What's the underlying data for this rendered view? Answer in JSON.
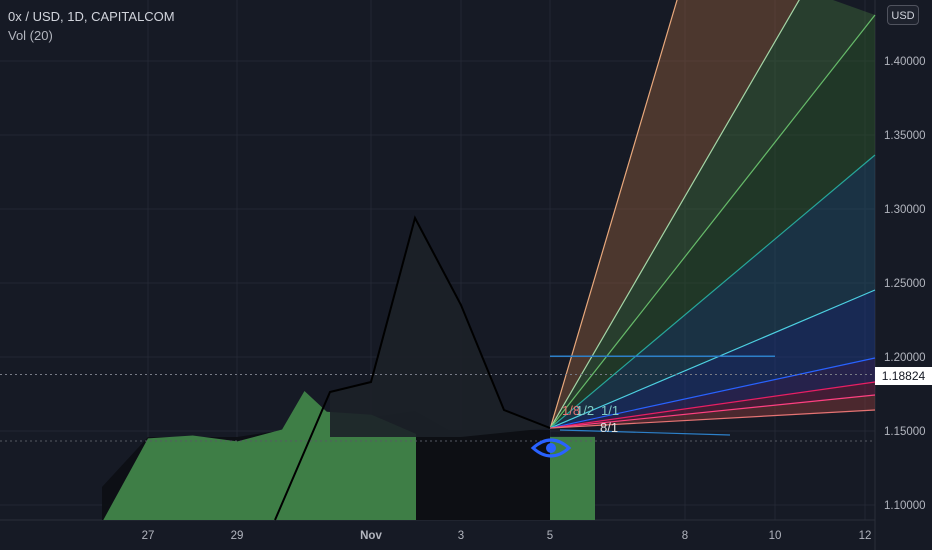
{
  "header": {
    "title": "0x / USD, 1D, CAPITALCOM",
    "volume_label": "Vol (20)"
  },
  "currency_button": "USD",
  "current_price": "1.18824",
  "colors": {
    "background": "#161a25",
    "price_line": "#000000",
    "volume_bar": "#3e7e46"
  },
  "chart_data": {
    "type": "area",
    "title": "0x / USD, 1D, CAPITALCOM",
    "y_axis": {
      "ticks": [
        "1.40000",
        "1.35000",
        "1.30000",
        "1.25000",
        "1.20000",
        "1.15000",
        "1.10000"
      ],
      "range": [
        1.088,
        1.43
      ],
      "position": "right"
    },
    "x_axis": {
      "ticks": [
        "27",
        "29",
        "Nov",
        "3",
        "5",
        "8",
        "10",
        "12"
      ]
    },
    "series": [
      {
        "name": "",
        "type": "line",
        "points": [
          {
            "x": "Oct 29",
            "y": 1.09
          },
          {
            "x": "Oct 30",
            "y": 1.165
          },
          {
            "x": "Oct 31",
            "y": 1.17
          },
          {
            "x": "Nov 1",
            "y": 1.295
          },
          {
            "x": "Nov 2",
            "y": 1.235
          },
          {
            "x": "Nov 3",
            "y": 1.155
          },
          {
            "x": "Nov 4",
            "y": 1.146
          }
        ]
      }
    ],
    "volume_area": [
      {
        "x": "Oct 26",
        "y": 1.113
      },
      {
        "x": "Oct 27",
        "y": 1.145
      },
      {
        "x": "Oct 28",
        "y": 1.147
      },
      {
        "x": "Oct 29",
        "y": 1.143
      },
      {
        "x": "Oct 30",
        "y": 1.151
      },
      {
        "x": "Oct 30.5",
        "y": 1.177
      },
      {
        "x": "Oct 31",
        "y": 1.163
      },
      {
        "x": "Nov 1",
        "y": 1.161
      },
      {
        "x": "Nov 2",
        "y": 1.148
      },
      {
        "x": "Nov 3",
        "y": 1.146
      },
      {
        "x": "Nov 5",
        "y": 1.146
      },
      {
        "x": "Nov 6",
        "y": 1.146
      }
    ],
    "gann_fan": {
      "origin": {
        "x": "Nov 5",
        "y": 1.152
      },
      "labels": [
        "1/8",
        "1/2",
        "1/1",
        "8/1"
      ]
    },
    "horizontal_lines": [
      {
        "y": 1.2005
      },
      {
        "y": 1.1882
      }
    ],
    "grid": true,
    "legend": "none"
  }
}
